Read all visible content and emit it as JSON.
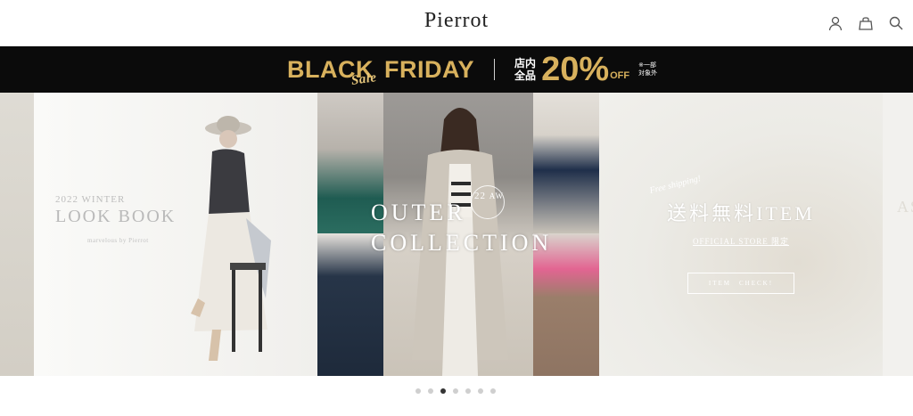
{
  "header": {
    "logo": "Pierrot",
    "icons": [
      "user-icon",
      "bag-icon",
      "search-icon"
    ]
  },
  "banner": {
    "black": "BLACK",
    "friday": "FRIDAY",
    "sale_script": "Sale",
    "tennai_line1": "店内",
    "tennai_line2": "全品",
    "percent": "20%",
    "off": "OFF",
    "note_line1": "※一部",
    "note_line2": "対象外",
    "colors": {
      "gold": "#d8b15d",
      "background": "#0b0b0b"
    }
  },
  "slides": {
    "lookbook": {
      "year": "2022 WINTER",
      "title": "LOOK BOOK",
      "sub": "marvelous by Pierrot"
    },
    "outer": {
      "title_line1": "OUTER",
      "title_line2": "COLLECTION",
      "badge_num": "22",
      "badge_text": "AW"
    },
    "free": {
      "script": "Free shipping!",
      "title": "送料無料ITEM",
      "sub": "OFFICIAL STORE 限定",
      "button": "ITEM　CHECK!"
    },
    "next_partial": "AS"
  },
  "pager": {
    "count": 7,
    "active_index": 2
  }
}
